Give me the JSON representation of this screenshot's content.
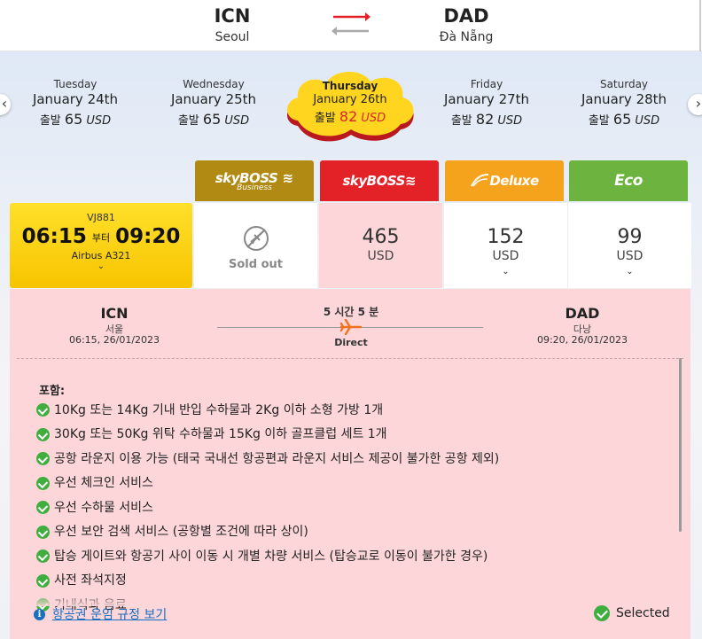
{
  "route": {
    "origin_code": "ICN",
    "origin_city": "Seoul",
    "destination_code": "DAD",
    "destination_city": "Đà Nẵng"
  },
  "dates": [
    {
      "weekday": "Tuesday",
      "date": "January 24th",
      "prefix": "출발",
      "amount": "65",
      "currency": "USD"
    },
    {
      "weekday": "Wednesday",
      "date": "January 25th",
      "prefix": "출발",
      "amount": "65",
      "currency": "USD"
    },
    {
      "weekday": "Thursday",
      "date": "January 26th",
      "prefix": "출발",
      "amount": "82",
      "currency": "USD"
    },
    {
      "weekday": "Friday",
      "date": "January 27th",
      "prefix": "출발",
      "amount": "82",
      "currency": "USD"
    },
    {
      "weekday": "Saturday",
      "date": "January 28th",
      "prefix": "출발",
      "amount": "65",
      "currency": "USD"
    }
  ],
  "nav": {
    "prev": "‹",
    "next": "›"
  },
  "fare_classes": [
    {
      "brand": "skyBOSS",
      "sub": "Business",
      "color": "#b08a12"
    },
    {
      "brand": "skyBOSS",
      "sub": "",
      "color": "#e32228"
    },
    {
      "brand": "Deluxe",
      "sub": "",
      "color": "#f5a21d"
    },
    {
      "brand": "Eco",
      "sub": "",
      "color": "#6db33f"
    }
  ],
  "flight": {
    "number": "VJ881",
    "depart_time": "06:15",
    "to_word": "부터",
    "arrive_time": "09:20",
    "aircraft": "Airbus A321"
  },
  "fares": {
    "business": {
      "status": "Sold out"
    },
    "boss": {
      "amount": "465",
      "currency": "USD"
    },
    "deluxe": {
      "amount": "152",
      "currency": "USD"
    },
    "eco": {
      "amount": "99",
      "currency": "USD"
    }
  },
  "detail": {
    "origin_code": "ICN",
    "origin_city": "서울",
    "origin_datetime": "06:15, 26/01/2023",
    "destination_code": "DAD",
    "destination_city": "다낭",
    "destination_datetime": "09:20, 26/01/2023",
    "duration": "5 시간 5 분",
    "stops": "Direct",
    "includes_title": "포함:",
    "includes": [
      "10Kg 또는 14Kg 기내 반입 수하물과 2Kg 이하 소형 가방 1개",
      "30Kg 또는 50Kg 위탁 수하물과 15Kg 이하 골프클럽 세트 1개",
      "공항 라운지 이용 가능 (태국 국내선 항공편과 라운지 서비스 제공이 불가한 공항 제외)",
      "우선 체크인 서비스",
      "우선 수하물 서비스",
      "우선 보안 검색 서비스 (공항별 조건에 따라 상이)",
      "탑승 게이트와 항공기 사이 이동 시 개별 차량 서비스 (탑승교로 이동이 불가한 경우)",
      "사전 좌석지정",
      "기내식과 음료"
    ],
    "fare_rules_link": "항공권 운임 규정 보기",
    "selected_label": "Selected"
  },
  "colors": {
    "selected_fare_bg": "#fcd6d9",
    "flight_card": "#ffd400",
    "accent_red": "#d8262c",
    "check_green": "#3fae3f",
    "link_blue": "#1a6ec0"
  }
}
